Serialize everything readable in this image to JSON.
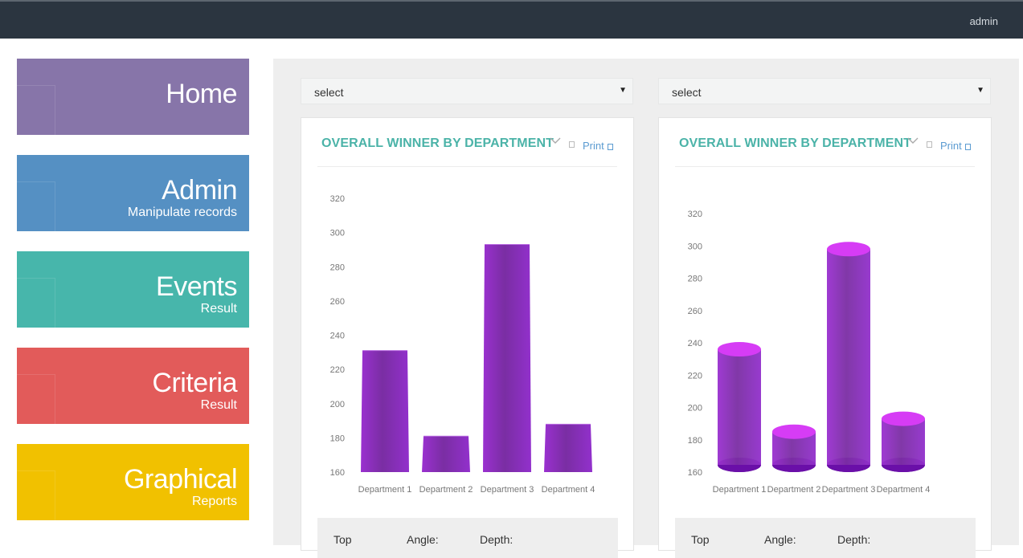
{
  "topbar": {
    "user": "admin"
  },
  "sidebar": {
    "tiles": [
      {
        "title": "Home",
        "subtitle": "",
        "color": "#8775a9"
      },
      {
        "title": "Admin",
        "subtitle": "Manipulate records",
        "color": "#5590c3"
      },
      {
        "title": "Events",
        "subtitle": "Result",
        "color": "#47b6ab"
      },
      {
        "title": "Criteria",
        "subtitle": "Result",
        "color": "#e25b5a"
      },
      {
        "title": "Graphical",
        "subtitle": "Reports",
        "color": "#f1c100"
      }
    ]
  },
  "selects": [
    {
      "value": "select"
    },
    {
      "value": "select"
    }
  ],
  "panels": [
    {
      "title": "OVERALL WINNER BY DEPARTMENT",
      "print_label": "Print",
      "controls": {
        "top": "Top",
        "angle": "Angle:",
        "depth": "Depth:"
      }
    },
    {
      "title": "OVERALL WINNER BY DEPARTMENT",
      "print_label": "Print",
      "controls": {
        "top": "Top",
        "angle": "Angle:",
        "depth": "Depth:"
      }
    }
  ],
  "chart_data": [
    {
      "type": "bar",
      "style": "3d-column",
      "title": "OVERALL WINNER BY DEPARTMENT",
      "categories": [
        "Department 1",
        "Department 2",
        "Department 3",
        "Department 4"
      ],
      "values": [
        231,
        181,
        293,
        188
      ],
      "yticks": [
        160,
        180,
        200,
        220,
        240,
        260,
        280,
        300,
        320
      ],
      "ylim": [
        160,
        320
      ],
      "xlabel": "",
      "ylabel": "",
      "grid": false,
      "color": "#8a2cc4"
    },
    {
      "type": "bar",
      "style": "3d-cylinder",
      "title": "OVERALL WINNER BY DEPARTMENT",
      "categories": [
        "Department 1",
        "Department 2",
        "Department 3",
        "Department 4"
      ],
      "values": [
        236,
        185,
        298,
        193
      ],
      "yticks": [
        160,
        180,
        200,
        220,
        240,
        260,
        280,
        300,
        320
      ],
      "ylim": [
        160,
        320
      ],
      "xlabel": "",
      "ylabel": "",
      "grid": false,
      "color": "#8a2cc4",
      "top_color": "#d63cf5"
    }
  ]
}
